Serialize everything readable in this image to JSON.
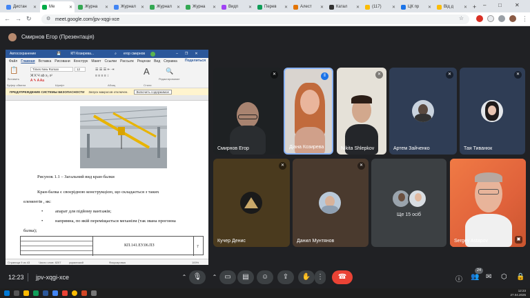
{
  "browser": {
    "tabs": [
      {
        "label": "Дистан",
        "color": "#4285f4"
      },
      {
        "label": "Ме",
        "color": "#00ac47",
        "active": true
      },
      {
        "label": "Журна",
        "color": "#34a853"
      },
      {
        "label": "Журнал",
        "color": "#4285f4"
      },
      {
        "label": "Журнал",
        "color": "#34a853"
      },
      {
        "label": "Журна",
        "color": "#34a853"
      },
      {
        "label": "Видп",
        "color": "#a142f4"
      },
      {
        "label": "Перев",
        "color": "#0f9d58"
      },
      {
        "label": "Алест",
        "color": "#e37400"
      },
      {
        "label": "Катал",
        "color": "#333333"
      },
      {
        "label": "(117)",
        "color": "#fbbc04"
      },
      {
        "label": "ЦК пр",
        "color": "#1a73e8"
      },
      {
        "label": "Від д",
        "color": "#fbbc04"
      }
    ],
    "new_tab": "+",
    "url": "meet.google.com/jpv-xqgi-xce"
  },
  "presenter": {
    "label": "Смирнов Егор (Презентація)"
  },
  "word": {
    "autosave": "Автосохранение",
    "doc_name": "КП Козирева...",
    "user": "егор смирнов",
    "menu_tabs": [
      "Файл",
      "Главная",
      "Вставка",
      "Рисовани",
      "Конструк",
      "Макет",
      "Ссылки",
      "Рассылк",
      "Рецензи",
      "Вид",
      "Справка"
    ],
    "selected_tab": "Главная",
    "share": "Поделиться",
    "font_name": "Times New Roman",
    "font_size": "12",
    "paste": "Вставить",
    "clipboard": "Буфер обмена",
    "font_group": "Шрифт",
    "paragraph_group": "Абзац",
    "styles_group": "Стили",
    "editing": "Редактирование",
    "security_title": "ПРЕДУПРЕЖДЕНИЕ СИСТЕМЫ БЕЗОПАСНОСТИ",
    "security_msg": "Запуск макросов отключен.",
    "enable_content": "Включить содержимое",
    "caption": "Рисунок 1.1 – Загальний вид кран-балки",
    "para1_a": "Кран-балка   є   своєрідною   конструкцією,  що   складається   з   таких",
    "para1_b": "елементів , як:",
    "bullet1": "апарат для підйому вантажів;",
    "bullet2_a": "напрямна,  по  якій  переміщається  механізм  (так  звана  прогонна",
    "bullet2_b": "балка);",
    "stamp_code": "КП.141.ЕУ.06.ПЗ",
    "page_number": "7",
    "status_page": "Страница 9 из 43",
    "status_words": "Число слов: 8207",
    "status_lang": "украинский",
    "status_focus": "Фокусировка",
    "zoom": "100%"
  },
  "participants": [
    {
      "name": "Смирнов Егор",
      "mic": "off"
    },
    {
      "name": "Діана Козирева",
      "mic": "on"
    },
    {
      "name": "Nikita Shlepkov",
      "mic": "off"
    },
    {
      "name": "Артем Зайченко",
      "mic": "off"
    },
    {
      "name": "Тая Тиванюк",
      "mic": "off"
    },
    {
      "name": "Кучер Денис",
      "mic": "off"
    },
    {
      "name": "Данил Мунтянов",
      "mic": "off"
    },
    {
      "name": "Ще 15 осіб"
    },
    {
      "name": "Sergey Astapov"
    }
  ],
  "bottom": {
    "time": "12:23",
    "code": "jpv-xqgi-xce",
    "people_count": "24"
  },
  "taskbar": {
    "time": "12:23",
    "date": "27.04.2025"
  },
  "colors": {
    "meet_bg": "#202124",
    "end_call": "#ea4335",
    "word_blue": "#2b579a",
    "security_bar": "#fff4ce"
  }
}
